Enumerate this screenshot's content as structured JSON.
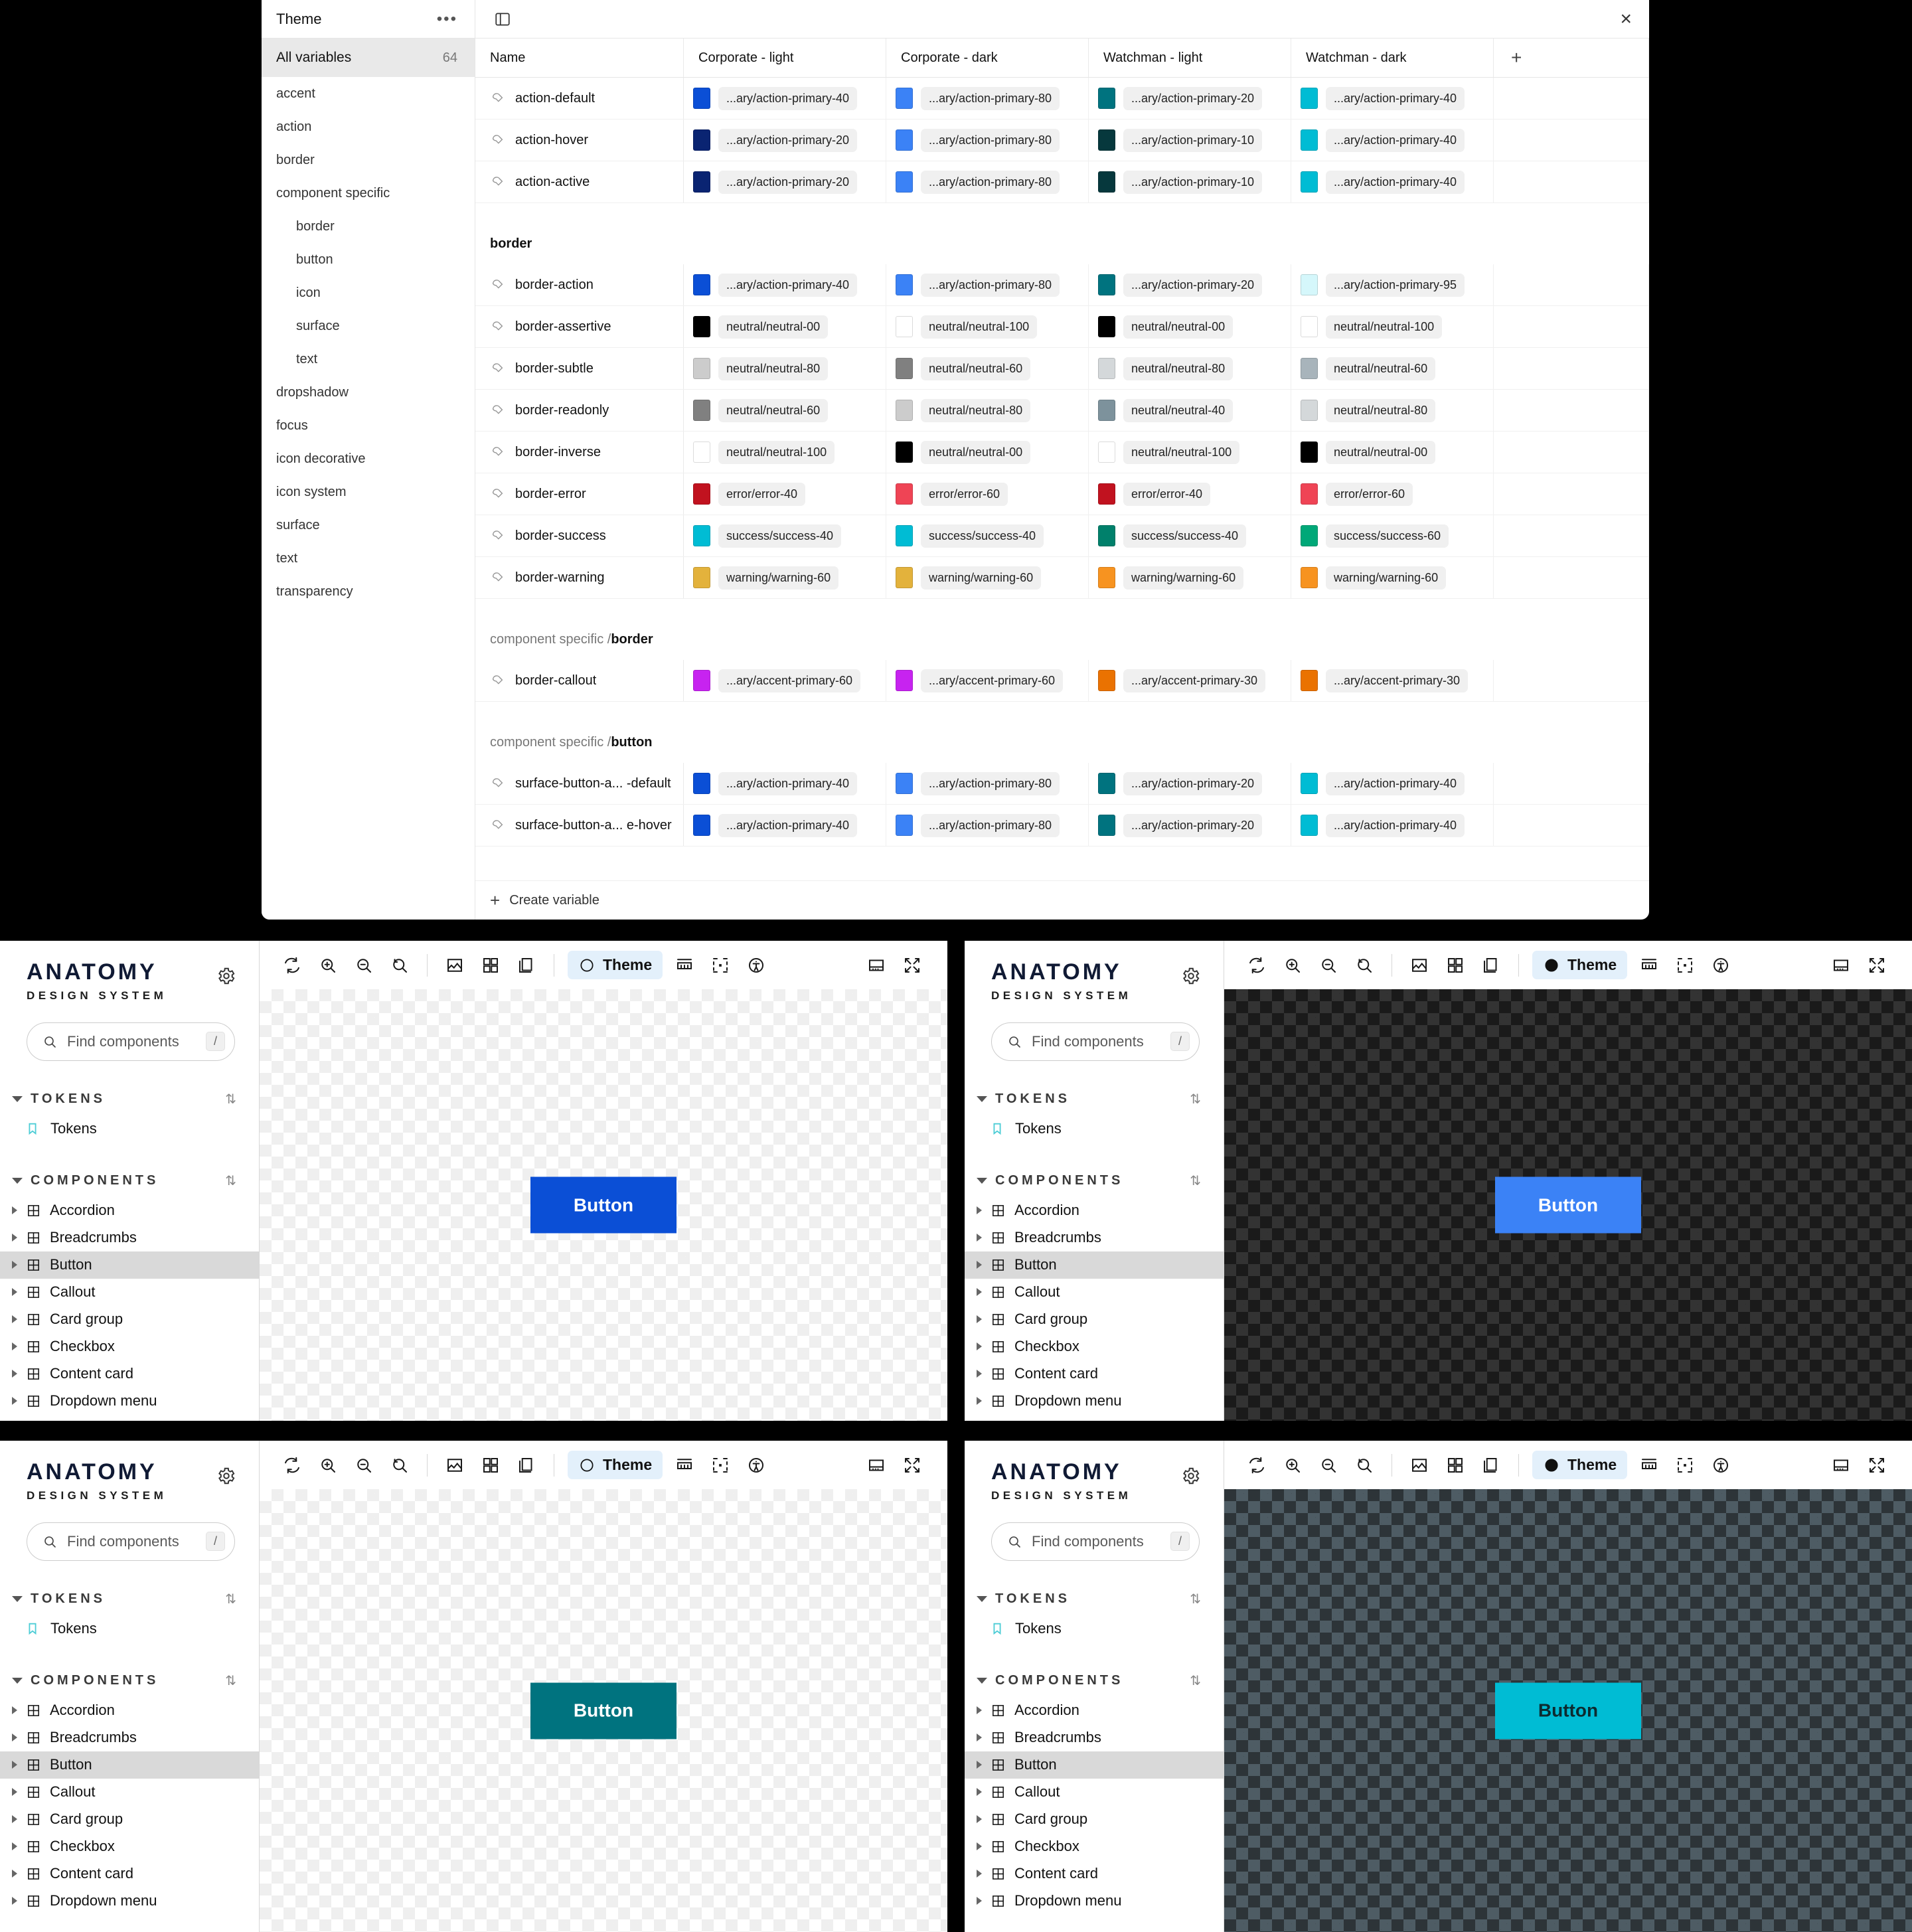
{
  "variables_modal": {
    "tab_title": "Theme",
    "more_label": "•••",
    "close_label": "×",
    "all_variables_label": "All variables",
    "all_variables_count": "64",
    "categories": [
      {
        "label": "accent",
        "sub": false
      },
      {
        "label": "action",
        "sub": false
      },
      {
        "label": "border",
        "sub": false
      },
      {
        "label": "component specific",
        "sub": false
      },
      {
        "label": "border",
        "sub": true
      },
      {
        "label": "button",
        "sub": true
      },
      {
        "label": "icon",
        "sub": true
      },
      {
        "label": "surface",
        "sub": true
      },
      {
        "label": "text",
        "sub": true
      },
      {
        "label": "dropshadow",
        "sub": false
      },
      {
        "label": "focus",
        "sub": false
      },
      {
        "label": "icon decorative",
        "sub": false
      },
      {
        "label": "icon system",
        "sub": false
      },
      {
        "label": "surface",
        "sub": false
      },
      {
        "label": "text",
        "sub": false
      },
      {
        "label": "transparency",
        "sub": false
      }
    ],
    "columns": [
      "Name",
      "Corporate - light",
      "Corporate - dark",
      "Watchman - light",
      "Watchman - dark"
    ],
    "add_column_label": "+",
    "create_variable_label": "Create variable",
    "rows": [
      {
        "kind": "row",
        "name": "action-default",
        "values": [
          {
            "color": "#0b4fd6",
            "text": "...ary/action-primary-40"
          },
          {
            "color": "#3b82f6",
            "text": "...ary/action-primary-80"
          },
          {
            "color": "#00737f",
            "text": "...ary/action-primary-20"
          },
          {
            "color": "#00bcd4",
            "text": "...ary/action-primary-40"
          }
        ]
      },
      {
        "kind": "row",
        "name": "action-hover",
        "values": [
          {
            "color": "#0a2472",
            "text": "...ary/action-primary-20"
          },
          {
            "color": "#3b82f6",
            "text": "...ary/action-primary-80"
          },
          {
            "color": "#06383d",
            "text": "...ary/action-primary-10"
          },
          {
            "color": "#00bcd4",
            "text": "...ary/action-primary-40"
          }
        ]
      },
      {
        "kind": "row",
        "name": "action-active",
        "values": [
          {
            "color": "#0a2472",
            "text": "...ary/action-primary-20"
          },
          {
            "color": "#3b82f6",
            "text": "...ary/action-primary-80"
          },
          {
            "color": "#06383d",
            "text": "...ary/action-primary-10"
          },
          {
            "color": "#00bcd4",
            "text": "...ary/action-primary-40"
          }
        ]
      },
      {
        "kind": "spacer"
      },
      {
        "kind": "group",
        "prefix": "",
        "name": "border"
      },
      {
        "kind": "row",
        "name": "border-action",
        "values": [
          {
            "color": "#0b4fd6",
            "text": "...ary/action-primary-40"
          },
          {
            "color": "#3b82f6",
            "text": "...ary/action-primary-80"
          },
          {
            "color": "#00737f",
            "text": "...ary/action-primary-20"
          },
          {
            "color": "#d5f7fb",
            "text": "...ary/action-primary-95"
          }
        ]
      },
      {
        "kind": "row",
        "name": "border-assertive",
        "values": [
          {
            "color": "#000000",
            "text": "neutral/neutral-00"
          },
          {
            "color": "#ffffff",
            "text": "neutral/neutral-100"
          },
          {
            "color": "#000000",
            "text": "neutral/neutral-00"
          },
          {
            "color": "#ffffff",
            "text": "neutral/neutral-100"
          }
        ]
      },
      {
        "kind": "row",
        "name": "border-subtle",
        "values": [
          {
            "color": "#cccccc",
            "text": "neutral/neutral-80"
          },
          {
            "color": "#808080",
            "text": "neutral/neutral-60"
          },
          {
            "color": "#d4d8da",
            "text": "neutral/neutral-80"
          },
          {
            "color": "#a8b4bb",
            "text": "neutral/neutral-60"
          }
        ]
      },
      {
        "kind": "row",
        "name": "border-readonly",
        "values": [
          {
            "color": "#808080",
            "text": "neutral/neutral-60"
          },
          {
            "color": "#cccccc",
            "text": "neutral/neutral-80"
          },
          {
            "color": "#7d929c",
            "text": "neutral/neutral-40"
          },
          {
            "color": "#d4d8da",
            "text": "neutral/neutral-80"
          }
        ]
      },
      {
        "kind": "row",
        "name": "border-inverse",
        "values": [
          {
            "color": "#ffffff",
            "text": "neutral/neutral-100"
          },
          {
            "color": "#000000",
            "text": "neutral/neutral-00"
          },
          {
            "color": "#ffffff",
            "text": "neutral/neutral-100"
          },
          {
            "color": "#000000",
            "text": "neutral/neutral-00"
          }
        ]
      },
      {
        "kind": "row",
        "name": "border-error",
        "values": [
          {
            "color": "#c1121f",
            "text": "error/error-40"
          },
          {
            "color": "#ef4455",
            "text": "error/error-60"
          },
          {
            "color": "#c1121f",
            "text": "error/error-40"
          },
          {
            "color": "#ef4455",
            "text": "error/error-60"
          }
        ]
      },
      {
        "kind": "row",
        "name": "border-success",
        "values": [
          {
            "color": "#00bcd4",
            "text": "success/success-40"
          },
          {
            "color": "#00bcd4",
            "text": "success/success-40"
          },
          {
            "color": "#00806b",
            "text": "success/success-40"
          },
          {
            "color": "#00a878",
            "text": "success/success-60"
          }
        ]
      },
      {
        "kind": "row",
        "name": "border-warning",
        "values": [
          {
            "color": "#e3b23c",
            "text": "warning/warning-60"
          },
          {
            "color": "#e3b23c",
            "text": "warning/warning-60"
          },
          {
            "color": "#f79320",
            "text": "warning/warning-60"
          },
          {
            "color": "#f79320",
            "text": "warning/warning-60"
          }
        ]
      },
      {
        "kind": "spacer"
      },
      {
        "kind": "group",
        "prefix": "component specific / ",
        "name": "border"
      },
      {
        "kind": "row",
        "name": "border-callout",
        "values": [
          {
            "color": "#c723f0",
            "text": "...ary/accent-primary-60"
          },
          {
            "color": "#c723f0",
            "text": "...ary/accent-primary-60"
          },
          {
            "color": "#ea7201",
            "text": "...ary/accent-primary-30"
          },
          {
            "color": "#ea7201",
            "text": "...ary/accent-primary-30"
          }
        ]
      },
      {
        "kind": "spacer"
      },
      {
        "kind": "group",
        "prefix": "component specific / ",
        "name": "button"
      },
      {
        "kind": "row",
        "name": "surface-button-a...  -default",
        "values": [
          {
            "color": "#0b4fd6",
            "text": "...ary/action-primary-40"
          },
          {
            "color": "#3b82f6",
            "text": "...ary/action-primary-80"
          },
          {
            "color": "#00737f",
            "text": "...ary/action-primary-20"
          },
          {
            "color": "#00bcd4",
            "text": "...ary/action-primary-40"
          }
        ]
      },
      {
        "kind": "row",
        "name": "surface-button-a...  e-hover",
        "values": [
          {
            "color": "#0b4fd6",
            "text": "...ary/action-primary-40"
          },
          {
            "color": "#3b82f6",
            "text": "...ary/action-primary-80"
          },
          {
            "color": "#00737f",
            "text": "...ary/action-primary-20"
          },
          {
            "color": "#00bcd4",
            "text": "...ary/action-primary-40"
          }
        ]
      }
    ]
  },
  "sidebar": {
    "brand_line1": "ANATOMY",
    "brand_line2": "DESIGN SYSTEM",
    "search_placeholder": "Find components",
    "search_shortcut": "/",
    "tokens_section_label": "TOKENS",
    "tokens_item_label": "Tokens",
    "components_section_label": "COMPONENTS",
    "components": [
      "Accordion",
      "Breadcrumbs",
      "Button",
      "Callout",
      "Card group",
      "Checkbox",
      "Content card",
      "Dropdown menu"
    ],
    "selected_component": "Button"
  },
  "toolbar": {
    "theme_label": "Theme"
  },
  "panels": [
    {
      "id": "corporate-light",
      "theme_mode": "light",
      "canvas": "light",
      "button_label": "Button",
      "button_bg": "#0b4fd6",
      "button_fg": "#ffffff"
    },
    {
      "id": "corporate-dark",
      "theme_mode": "dark",
      "canvas": "dark",
      "button_label": "Button",
      "button_bg": "#3b82f6",
      "button_fg": "#ffffff"
    },
    {
      "id": "watchman-light",
      "theme_mode": "light",
      "canvas": "light",
      "button_label": "Button",
      "button_bg": "#00737f",
      "button_fg": "#ffffff"
    },
    {
      "id": "watchman-dark",
      "theme_mode": "dark",
      "canvas": "slate",
      "button_label": "Button",
      "button_bg": "#00bcd4",
      "button_fg": "#0d2b30"
    }
  ]
}
